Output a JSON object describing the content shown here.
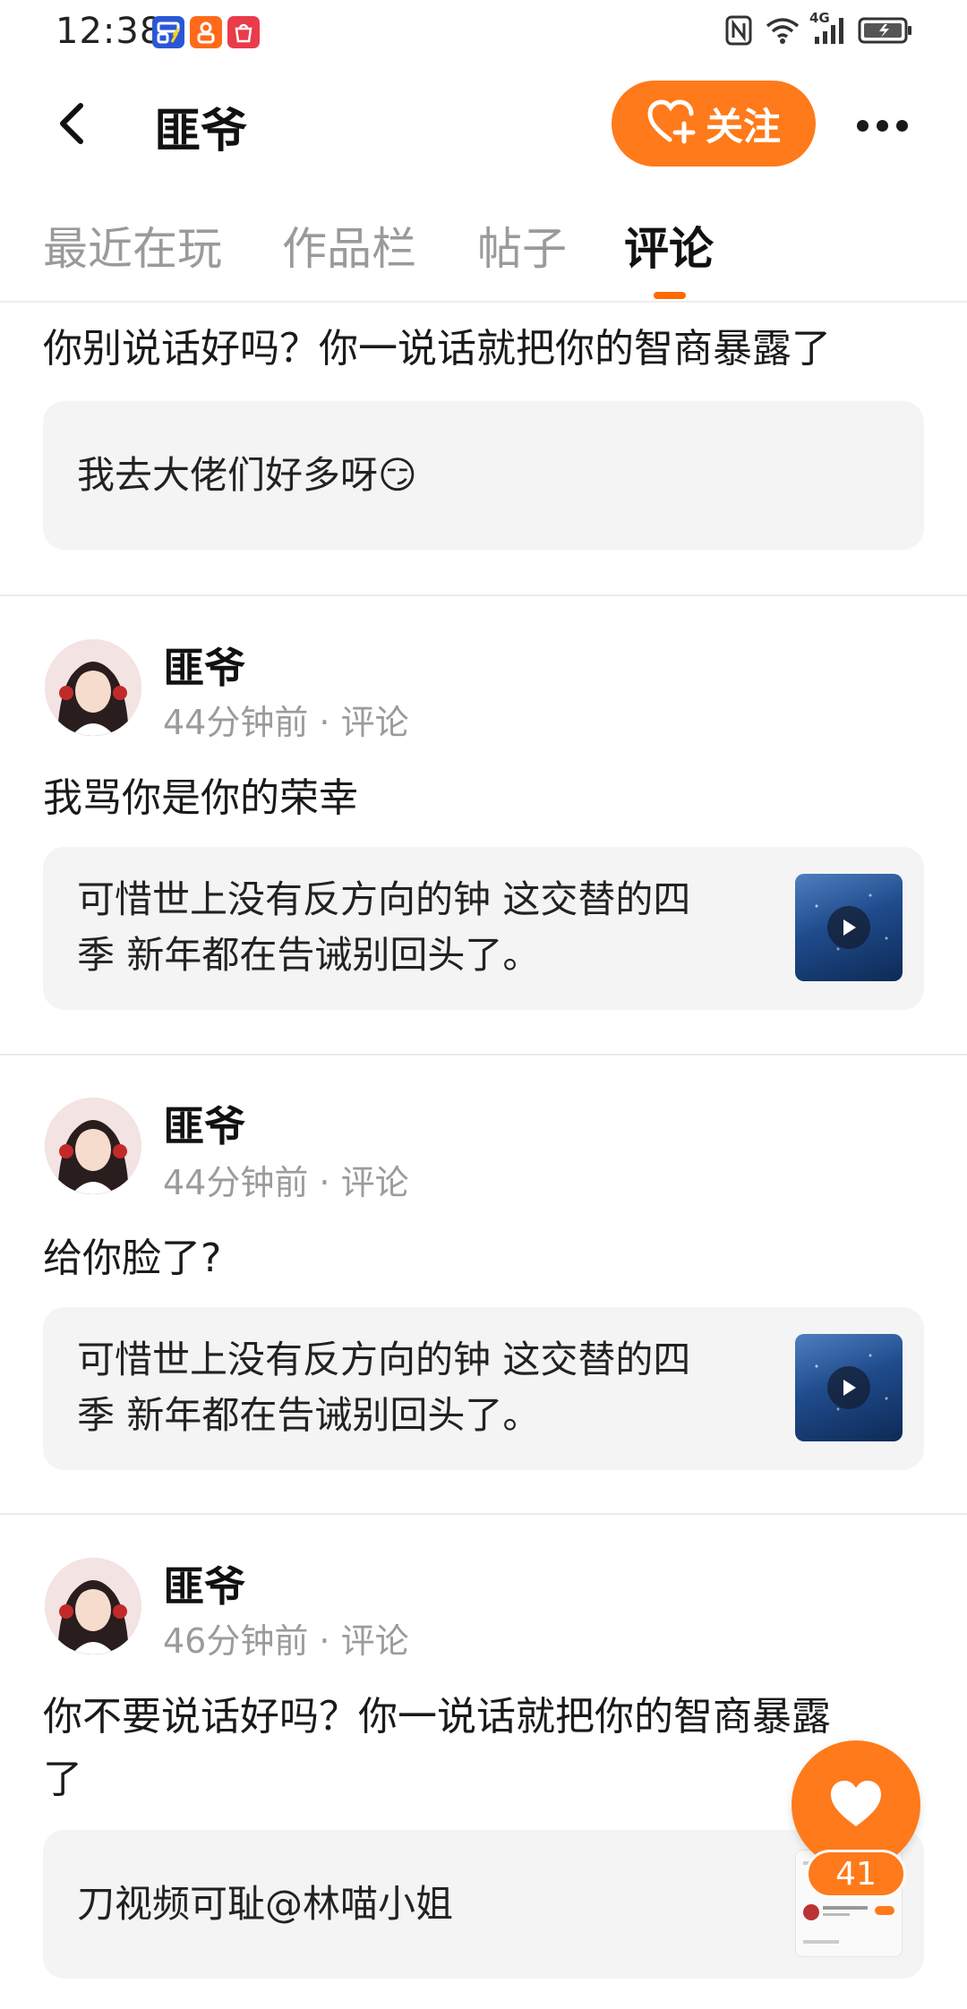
{
  "status_bar": {
    "time": "12:38",
    "network": "4G"
  },
  "header": {
    "title": "匪爷",
    "follow_label": "关注",
    "icons": [
      "back-arrow-icon",
      "heart-plus-icon",
      "more-icon"
    ]
  },
  "tabs": [
    {
      "label": "最近在玩",
      "active": false
    },
    {
      "label": "作品栏",
      "active": false
    },
    {
      "label": "帖子",
      "active": false
    },
    {
      "label": "评论",
      "active": true
    }
  ],
  "feed": [
    {
      "comment": "你别说话好吗？你一说话就把你的智商暴露了",
      "quote": "我去大佬们好多呀😏"
    },
    {
      "author": "匪爷",
      "meta": "44分钟前 · 评论",
      "comment": "我骂你是你的荣幸",
      "quote_line1": "可惜世上没有反方向的钟 这交替的四",
      "quote_line2": "季 新年都在告诫别回头了。"
    },
    {
      "author": "匪爷",
      "meta": "44分钟前 · 评论",
      "comment": "给你脸了?",
      "quote_line1": "可惜世上没有反方向的钟 这交替的四",
      "quote_line2": "季 新年都在告诫别回头了。"
    },
    {
      "author": "匪爷",
      "meta": "46分钟前 · 评论",
      "comment_line1": "你不要说话好吗？你一说话就把你的智商暴露",
      "comment_line2": "了",
      "quote": "刀视频可耻@林喵小姐"
    }
  ],
  "like": {
    "count": "41"
  },
  "colors": {
    "accent": "#ff7a1a",
    "quote_bg": "#f4f4f5",
    "meta_text": "#9b9b9b"
  }
}
